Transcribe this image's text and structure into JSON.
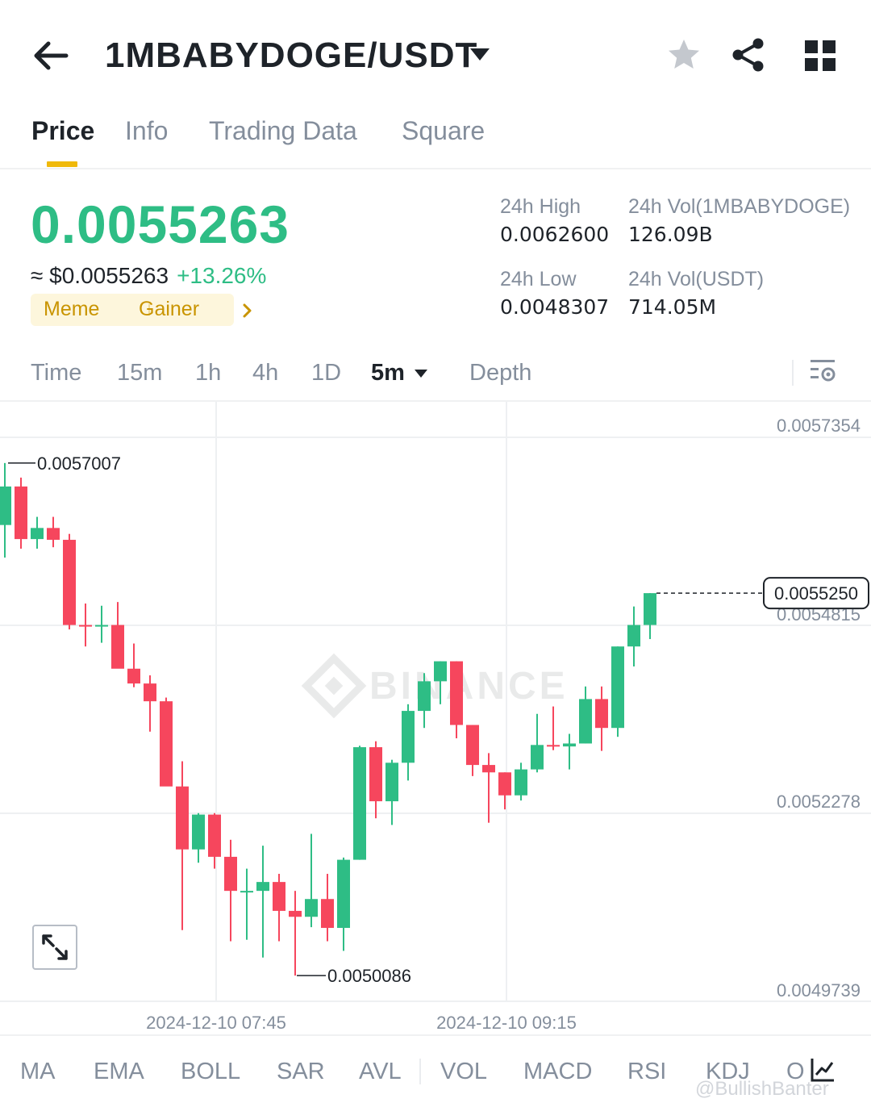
{
  "header": {
    "pair": "1MBABYDOGE/USDT"
  },
  "tabs": [
    {
      "label": "Price",
      "active": true
    },
    {
      "label": "Info",
      "active": false
    },
    {
      "label": "Trading Data",
      "active": false
    },
    {
      "label": "Square",
      "active": false
    }
  ],
  "ticker": {
    "last_price": "0.0055263",
    "usd_price": "≈ $0.0055263",
    "change_pct": "+13.26%",
    "tags": [
      "Meme",
      "Gainer"
    ],
    "high_label": "24h High",
    "high_value": "0.0062600",
    "low_label": "24h Low",
    "low_value": "0.0048307",
    "vol_base_label": "24h Vol(1MBABYDOGE)",
    "vol_base_value": "126.09B",
    "vol_quote_label": "24h Vol(USDT)",
    "vol_quote_value": "714.05M"
  },
  "intervals": {
    "items": [
      "Time",
      "15m",
      "1h",
      "4h",
      "1D",
      "5m",
      "Depth"
    ],
    "active": "5m"
  },
  "colors": {
    "up": "#2ebd85",
    "down": "#f6465d",
    "accent": "#f0b90b"
  },
  "chart_data": {
    "type": "candlestick",
    "interval": "5m",
    "y_axis_ticks": [
      "0.0057354",
      "0.0054815",
      "0.0052278",
      "0.0049739"
    ],
    "ylim": [
      0.0049739,
      0.0057354
    ],
    "x_axis_ticks": [
      "2024-12-10 07:45",
      "2024-12-10 09:15"
    ],
    "current_price_label": "0.0055250",
    "current_price": 0.005525,
    "max_marker": {
      "label": "0.0057007",
      "value": 0.0057007
    },
    "min_marker": {
      "label": "0.0050086",
      "value": 0.0050086
    },
    "watermark": "BINANCE",
    "candles": [
      {
        "o": 0.005617,
        "h": 0.0057007,
        "l": 0.005573,
        "c": 0.005669
      },
      {
        "o": 0.005669,
        "h": 0.005681,
        "l": 0.005585,
        "c": 0.005598
      },
      {
        "o": 0.005598,
        "h": 0.005628,
        "l": 0.005585,
        "c": 0.005613
      },
      {
        "o": 0.005613,
        "h": 0.005628,
        "l": 0.005587,
        "c": 0.005597
      },
      {
        "o": 0.005597,
        "h": 0.005605,
        "l": 0.005476,
        "c": 0.005482
      },
      {
        "o": 0.005482,
        "h": 0.005511,
        "l": 0.005453,
        "c": 0.00548
      },
      {
        "o": 0.00548,
        "h": 0.005508,
        "l": 0.005458,
        "c": 0.005482
      },
      {
        "o": 0.005482,
        "h": 0.005513,
        "l": 0.005436,
        "c": 0.005423
      },
      {
        "o": 0.005423,
        "h": 0.005457,
        "l": 0.005398,
        "c": 0.005403
      },
      {
        "o": 0.005403,
        "h": 0.005414,
        "l": 0.005338,
        "c": 0.005379
      },
      {
        "o": 0.005379,
        "h": 0.005384,
        "l": 0.005275,
        "c": 0.005264
      },
      {
        "o": 0.005264,
        "h": 0.005298,
        "l": 0.00507,
        "c": 0.005179
      },
      {
        "o": 0.005179,
        "h": 0.005228,
        "l": 0.005161,
        "c": 0.005226
      },
      {
        "o": 0.005226,
        "h": 0.005228,
        "l": 0.005153,
        "c": 0.005169
      },
      {
        "o": 0.005169,
        "h": 0.005192,
        "l": 0.005055,
        "c": 0.005123
      },
      {
        "o": 0.005123,
        "h": 0.005153,
        "l": 0.005057,
        "c": 0.005123
      },
      {
        "o": 0.005123,
        "h": 0.005184,
        "l": 0.005033,
        "c": 0.005135
      },
      {
        "o": 0.005135,
        "h": 0.005146,
        "l": 0.005055,
        "c": 0.005096
      },
      {
        "o": 0.005096,
        "h": 0.005123,
        "l": 0.0050086,
        "c": 0.005088
      },
      {
        "o": 0.005088,
        "h": 0.0052,
        "l": 0.005074,
        "c": 0.005112
      },
      {
        "o": 0.005112,
        "h": 0.005146,
        "l": 0.005055,
        "c": 0.005073
      },
      {
        "o": 0.005073,
        "h": 0.005168,
        "l": 0.005042,
        "c": 0.005165
      },
      {
        "o": 0.005165,
        "h": 0.005319,
        "l": 0.005165,
        "c": 0.005317
      },
      {
        "o": 0.005317,
        "h": 0.005325,
        "l": 0.005221,
        "c": 0.005244
      },
      {
        "o": 0.005244,
        "h": 0.0053,
        "l": 0.005212,
        "c": 0.005296
      },
      {
        "o": 0.005296,
        "h": 0.005375,
        "l": 0.005272,
        "c": 0.005366
      },
      {
        "o": 0.005366,
        "h": 0.005417,
        "l": 0.005343,
        "c": 0.005406
      },
      {
        "o": 0.005406,
        "h": 0.005433,
        "l": 0.005375,
        "c": 0.005433
      },
      {
        "o": 0.005433,
        "h": 0.005433,
        "l": 0.005329,
        "c": 0.005347
      },
      {
        "o": 0.005347,
        "h": 0.005347,
        "l": 0.005278,
        "c": 0.005293
      },
      {
        "o": 0.005293,
        "h": 0.005309,
        "l": 0.005215,
        "c": 0.005283
      },
      {
        "o": 0.005283,
        "h": 0.005283,
        "l": 0.005233,
        "c": 0.005252
      },
      {
        "o": 0.005252,
        "h": 0.005296,
        "l": 0.005245,
        "c": 0.005287
      },
      {
        "o": 0.005287,
        "h": 0.005362,
        "l": 0.005283,
        "c": 0.00532
      },
      {
        "o": 0.00532,
        "h": 0.005372,
        "l": 0.005313,
        "c": 0.005318
      },
      {
        "o": 0.005318,
        "h": 0.005335,
        "l": 0.005287,
        "c": 0.005322
      },
      {
        "o": 0.005322,
        "h": 0.005399,
        "l": 0.005322,
        "c": 0.005382
      },
      {
        "o": 0.005382,
        "h": 0.005399,
        "l": 0.005312,
        "c": 0.005343
      },
      {
        "o": 0.005343,
        "h": 0.005453,
        "l": 0.005331,
        "c": 0.005453
      },
      {
        "o": 0.005453,
        "h": 0.005507,
        "l": 0.005426,
        "c": 0.005482
      },
      {
        "o": 0.005482,
        "h": 0.005525,
        "l": 0.005463,
        "c": 0.005525
      }
    ]
  },
  "indicators": {
    "items": [
      "MA",
      "EMA",
      "BOLL",
      "SAR",
      "AVL",
      "VOL",
      "MACD",
      "RSI",
      "KDJ",
      "O"
    ]
  },
  "watermark_handle": "@BullishBanter"
}
